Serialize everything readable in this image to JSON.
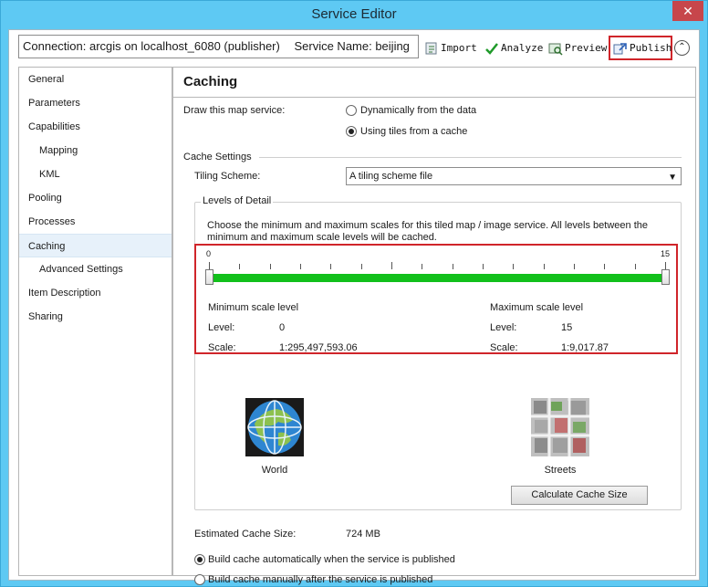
{
  "window": {
    "title": "Service Editor",
    "close_glyph": "✕"
  },
  "toolbar": {
    "connection_label": "Connection: arcgis on localhost_6080 (publisher)",
    "service_label": "Service Name: beijing",
    "import_label": "Import",
    "analyze_label": "Analyze",
    "preview_label": "Preview",
    "publish_label": "Publish",
    "collapse_glyph": "⌃"
  },
  "sidebar": {
    "items": [
      {
        "label": "General"
      },
      {
        "label": "Parameters"
      },
      {
        "label": "Capabilities"
      },
      {
        "label": "Mapping"
      },
      {
        "label": "KML"
      },
      {
        "label": "Pooling"
      },
      {
        "label": "Processes"
      },
      {
        "label": "Caching"
      },
      {
        "label": "Advanced Settings"
      },
      {
        "label": "Item Description"
      },
      {
        "label": "Sharing"
      }
    ],
    "selected": "Caching"
  },
  "caching": {
    "heading": "Caching",
    "draw_label": "Draw this map service:",
    "opt_dynamic": "Dynamically from the data",
    "opt_tiles": "Using tiles from a cache",
    "selected_draw_option": "Using tiles from a cache",
    "cache_settings_label": "Cache Settings",
    "tiling_scheme_label": "Tiling Scheme:",
    "tiling_scheme_value": "A tiling scheme file",
    "lod_title": "Levels of Detail",
    "lod_desc": "Choose the minimum and maximum scales for this tiled map / image service. All levels between the minimum and maximum scale levels will be cached.",
    "slider": {
      "min_label": "0",
      "max_label": "15",
      "min_value": 0,
      "max_value": 15,
      "steps": 15
    },
    "min_scale_title": "Minimum scale level",
    "max_scale_title": "Maximum scale level",
    "level_label": "Level:",
    "scale_label": "Scale:",
    "min_level": "0",
    "min_scale": "1:295,497,593.06",
    "max_level": "15",
    "max_scale": "1:9,017.87",
    "world_caption": "World",
    "streets_caption": "Streets",
    "estimated_label": "Estimated Cache Size:",
    "estimated_value": "724 MB",
    "calc_button": "Calculate Cache Size",
    "build_auto": "Build cache automatically when the service is published",
    "build_manual": "Build cache manually after the service is published",
    "selected_build_option": "Build cache automatically when the service is published"
  },
  "colors": {
    "title_bar": "#5ec9f3",
    "slider_track": "#12c01b",
    "highlight_box": "#d0252a",
    "selected_nav": "#e7f1fa"
  }
}
